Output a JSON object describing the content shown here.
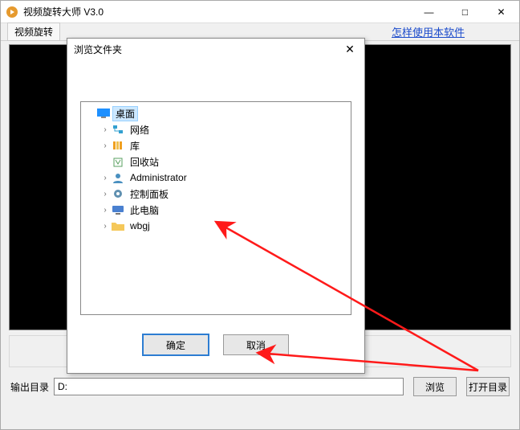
{
  "window": {
    "title": "视频旋转大师 V3.0",
    "controls": {
      "min": "—",
      "max": "□",
      "close": "✕"
    }
  },
  "menubar": {
    "video_rotate": "视频旋转",
    "help_link": "怎样使用本软件"
  },
  "bottom": {
    "output_label": "输出目录",
    "output_path": "D:",
    "browse": "浏览",
    "open_dir": "打开目录"
  },
  "dialog": {
    "title": "浏览文件夹",
    "close": "✕",
    "ok": "确定",
    "cancel": "取消",
    "tree": [
      {
        "label": "桌面",
        "level": 0,
        "expander": "",
        "selected": true,
        "icon": "desktop"
      },
      {
        "label": "网络",
        "level": 1,
        "expander": "›",
        "icon": "network"
      },
      {
        "label": "库",
        "level": 1,
        "expander": "›",
        "icon": "library"
      },
      {
        "label": "回收站",
        "level": 1,
        "expander": "",
        "icon": "recycle"
      },
      {
        "label": "Administrator",
        "level": 1,
        "expander": "›",
        "icon": "user"
      },
      {
        "label": "控制面板",
        "level": 1,
        "expander": "›",
        "icon": "control"
      },
      {
        "label": "此电脑",
        "level": 1,
        "expander": "›",
        "icon": "pc"
      },
      {
        "label": "wbgj",
        "level": 1,
        "expander": "›",
        "icon": "folder"
      }
    ]
  },
  "icons": {
    "desktop": "#1e90ff",
    "network": "#33a0d0",
    "library": "#f0a020",
    "recycle": "#5aa060",
    "user": "#4a90c0",
    "control": "#6090b0",
    "pc": "#4a80d0",
    "folder": "#f5c85a"
  }
}
